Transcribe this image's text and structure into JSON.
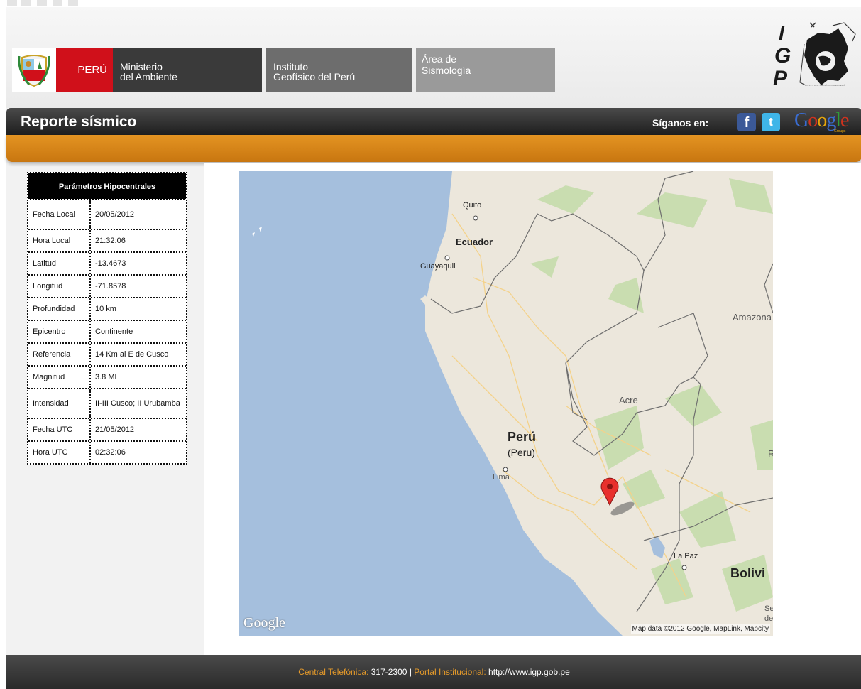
{
  "header": {
    "peru_label": "PERÚ",
    "ministerio": [
      "Ministerio",
      "del Ambiente"
    ],
    "instituto": [
      "Instituto",
      "Geofísico del Perú"
    ],
    "area": [
      "Área de",
      "Sismología"
    ],
    "logo_letters": [
      "I",
      "G",
      "P"
    ],
    "logo_tagline": "INSTITUTO GEOFÍSICO DEL PERÚ"
  },
  "title_bar": {
    "title": "Reporte sísmico",
    "social_label": "Síganos en:",
    "facebook": "f",
    "twitter": "t",
    "google": [
      "G",
      "o",
      "o",
      "g",
      "l",
      "e"
    ],
    "google_sub": "Groups"
  },
  "params": {
    "heading": "Parámetros Hipocentrales",
    "rows": [
      {
        "label": "Fecha Local",
        "value": "20/05/2012"
      },
      {
        "label": "Hora Local",
        "value": "21:32:06"
      },
      {
        "label": "Latitud",
        "value": "-13.4673"
      },
      {
        "label": "Longitud",
        "value": "-71.8578"
      },
      {
        "label": "Profundidad",
        "value": "10 km"
      },
      {
        "label": "Epicentro",
        "value": "Continente"
      },
      {
        "label": "Referencia",
        "value": "14 Km al E de Cusco"
      },
      {
        "label": "Magnitud",
        "value": "3.8 ML"
      },
      {
        "label": "Intensidad",
        "value": "II-III Cusco; II Urubamba"
      },
      {
        "label": "Fecha UTC",
        "value": "21/05/2012"
      },
      {
        "label": "Hora UTC",
        "value": "02:32:06"
      }
    ]
  },
  "map": {
    "labels": {
      "quito": "Quito",
      "ecuador": "Ecuador",
      "guayaquil": "Guayaquil",
      "amazonas": "Amazona",
      "acre": "Acre",
      "peru": "Perú",
      "peru_en": "(Peru)",
      "lima": "Lima",
      "r": "R",
      "la_paz": "La Paz",
      "bolivia": "Bolivi",
      "se": "Se",
      "de": "de"
    },
    "google_logo": "Google",
    "attribution": "Map data ©2012 Google, MapLink, Mapcity"
  },
  "footer": {
    "phone_label": "Central Telefónica:",
    "phone": "317-2300",
    "separator": "|",
    "portal_label": "Portal Institucional:",
    "portal_url": "http://www.igp.gob.pe"
  }
}
